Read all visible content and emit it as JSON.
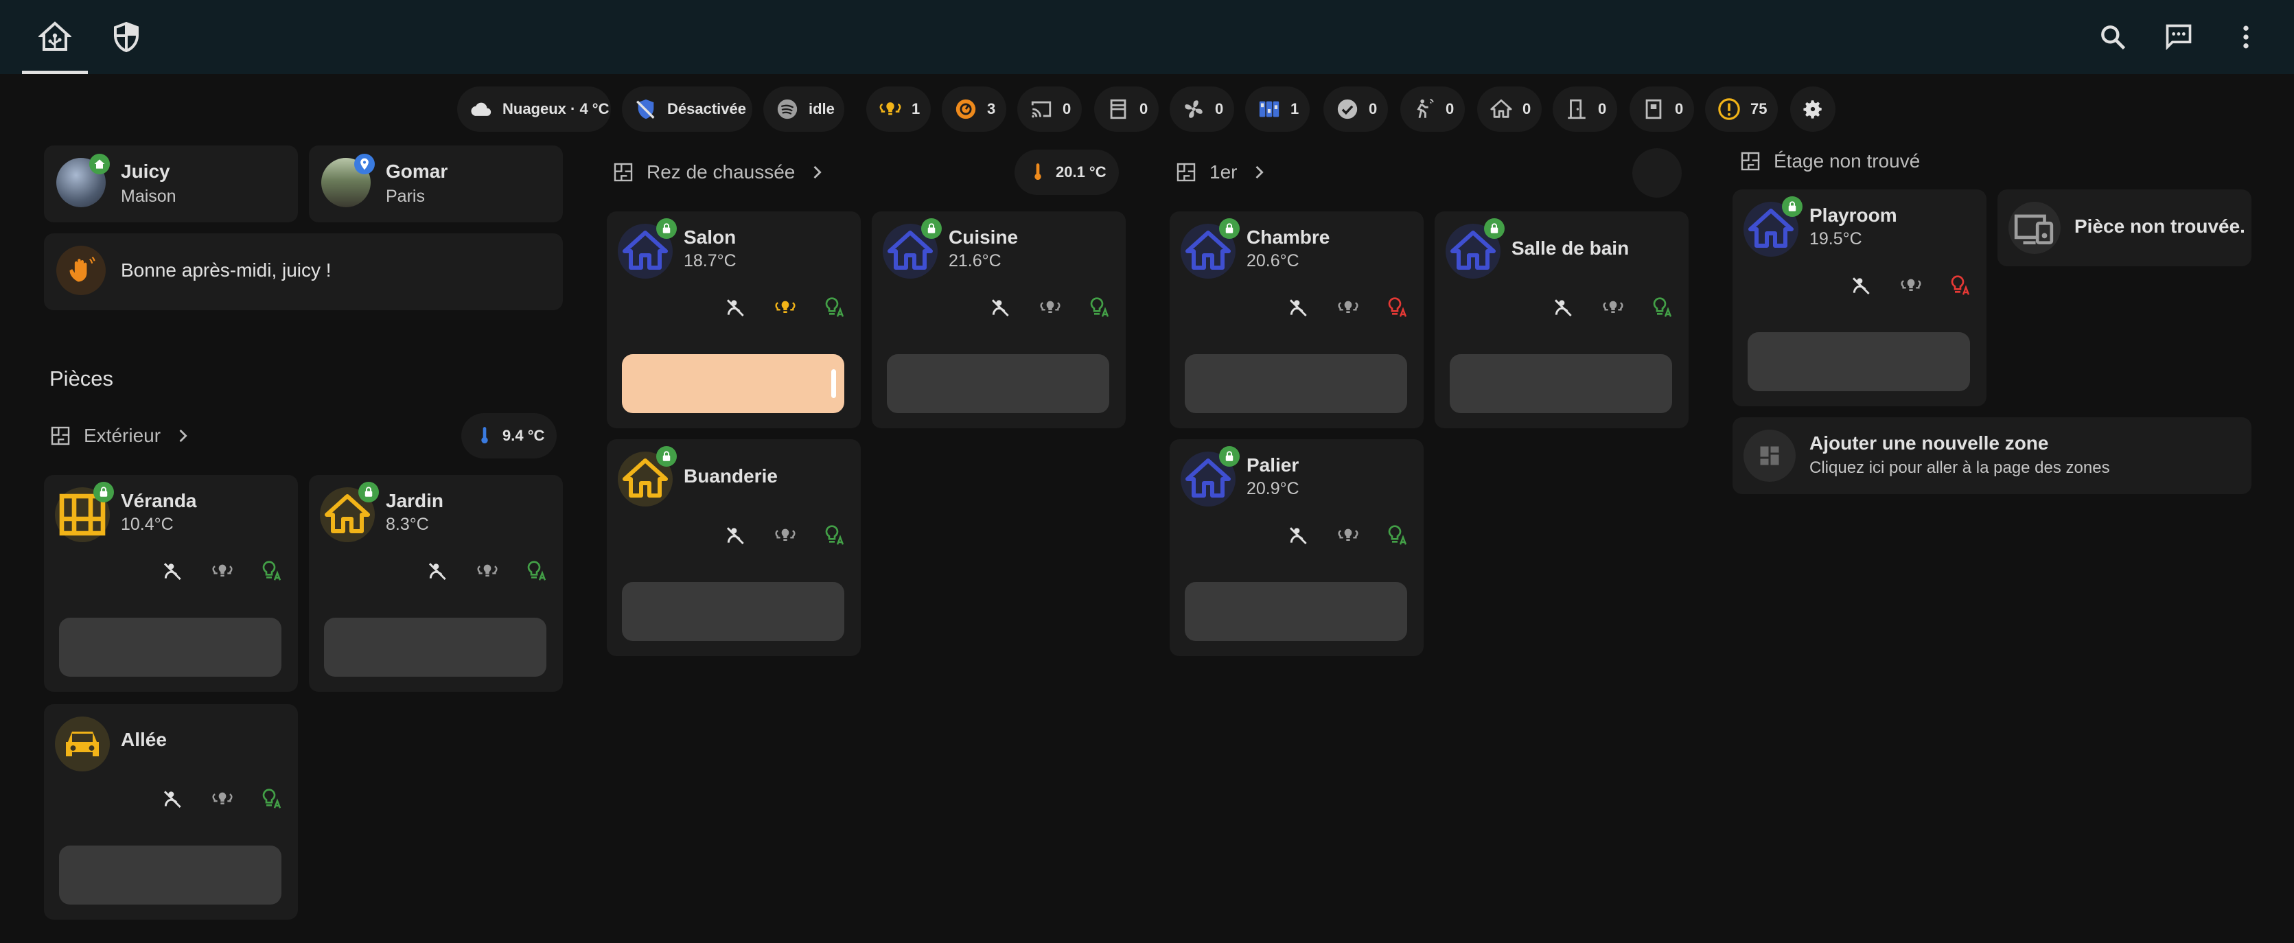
{
  "header": {
    "tabs": [
      {
        "name": "home-assistant",
        "icon": "home-assistant-icon"
      },
      {
        "name": "security",
        "icon": "shield-icon"
      }
    ],
    "actions": [
      "search-icon",
      "assist-icon",
      "more-vert-icon"
    ]
  },
  "chips": {
    "weather": "Nuageux · 4 °C",
    "alarm": "Désactivée",
    "spotify": "idle",
    "lights": "1",
    "climate": "3",
    "cast": "0",
    "covers": "0",
    "fans": "0",
    "media": "1",
    "binary": "0",
    "motion": "0",
    "presence": "0",
    "doors": "0",
    "windows": "0",
    "alerts": "75"
  },
  "persons": [
    {
      "name": "Juicy",
      "state": "Maison"
    },
    {
      "name": "Gomar",
      "state": "Paris"
    }
  ],
  "greeting": "Bonne après-midi, juicy !",
  "rooms_title": "Pièces",
  "floors": {
    "exterior": {
      "name": "Extérieur",
      "temp": "9.4 °C"
    },
    "ground": {
      "name": "Rez de chaussée",
      "temp": "20.1 °C"
    },
    "first": {
      "name": "1er"
    },
    "unknown": {
      "name": "Étage non trouvé"
    }
  },
  "rooms": {
    "veranda": {
      "name": "Véranda",
      "temp": "10.4°C"
    },
    "jardin": {
      "name": "Jardin",
      "temp": "8.3°C"
    },
    "allee": {
      "name": "Allée",
      "temp": ""
    },
    "salon": {
      "name": "Salon",
      "temp": "18.7°C"
    },
    "cuisine": {
      "name": "Cuisine",
      "temp": "21.6°C"
    },
    "buanderie": {
      "name": "Buanderie",
      "temp": ""
    },
    "chambre": {
      "name": "Chambre",
      "temp": "20.6°C"
    },
    "salle_de_bain": {
      "name": "Salle de bain",
      "temp": ""
    },
    "palier": {
      "name": "Palier",
      "temp": "20.9°C"
    },
    "playroom": {
      "name": "Playroom",
      "temp": "19.5°C"
    }
  },
  "room_not_found": "Pièce non trouvée.",
  "add_zone": {
    "title": "Ajouter une nouvelle zone",
    "subtitle": "Cliquez ici pour aller à la page des zones"
  },
  "colors": {
    "header": "#101e24",
    "card": "#1c1c1c",
    "accent_yellow": "#f2b418",
    "accent_orange": "#ee8a1c",
    "accent_green": "#43a047",
    "accent_red": "#e53935",
    "house_blue": "#3f4fd1",
    "light_on": "#f7c9a2"
  }
}
